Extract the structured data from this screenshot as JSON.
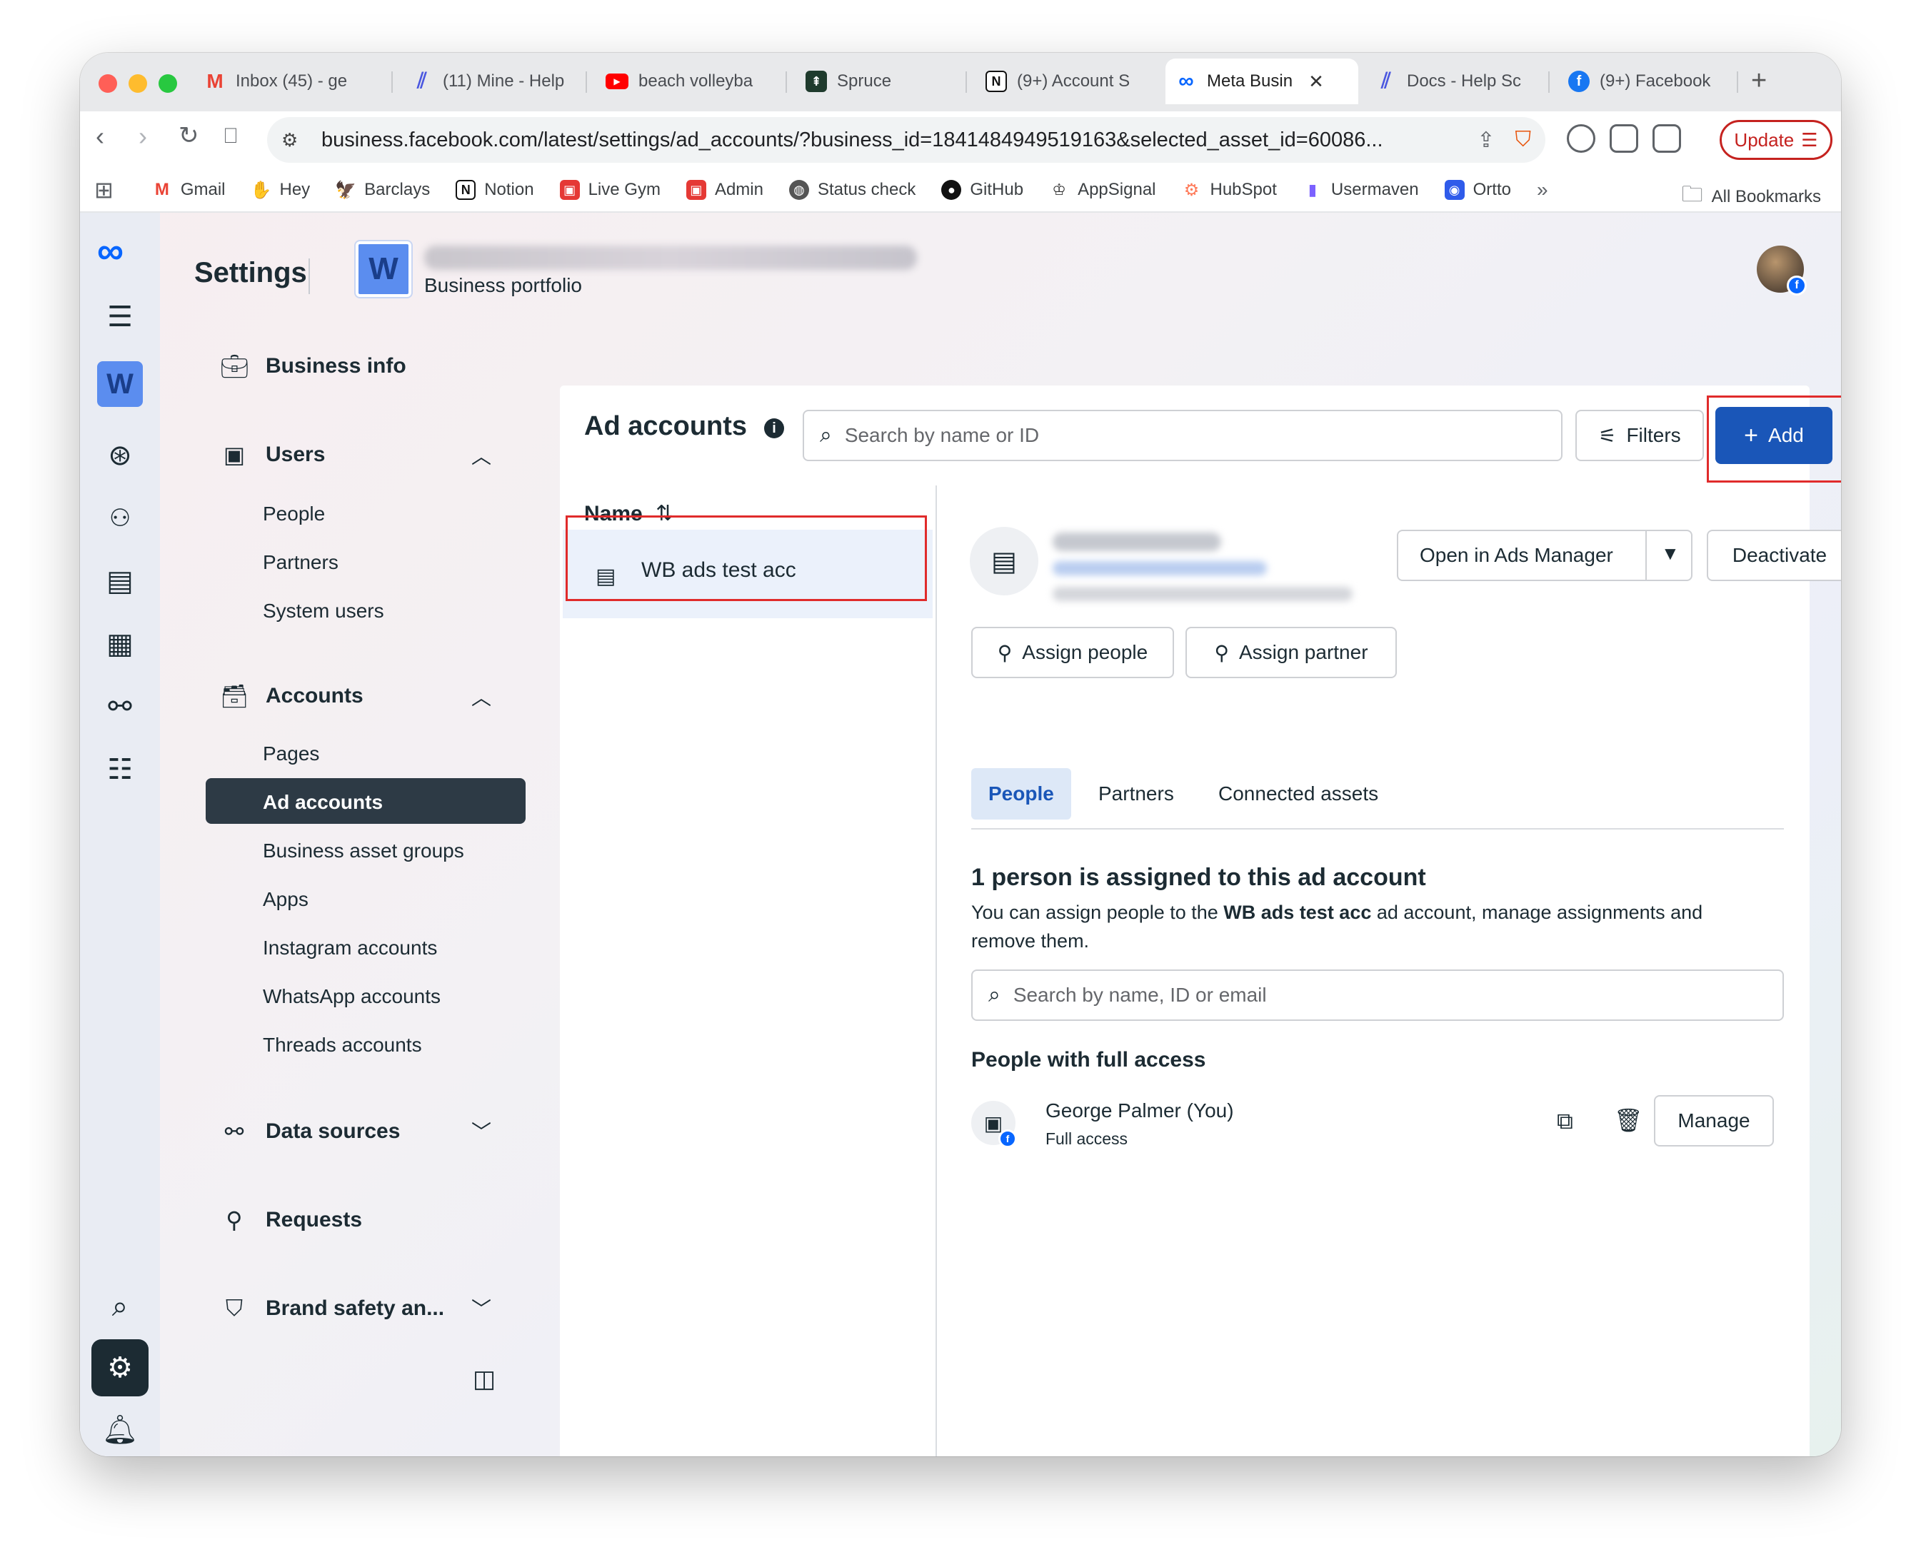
{
  "browser": {
    "tabs": [
      {
        "label": "Inbox (45) - ge",
        "icon": "gmail-icon",
        "color": "#ea4335"
      },
      {
        "label": "(11) Mine - Help",
        "icon": "helpscout-icon",
        "color": "#4a57e0"
      },
      {
        "label": "beach volleyba",
        "icon": "youtube-icon",
        "color": "#ff0000"
      },
      {
        "label": "Spruce",
        "icon": "spruce-icon",
        "color": "#1f3b2d"
      },
      {
        "label": "(9+) Account S",
        "icon": "notion-icon",
        "color": "#111111"
      },
      {
        "label": "Meta Busin",
        "icon": "meta-icon",
        "color": "#0866ff"
      },
      {
        "label": "Docs - Help Sc",
        "icon": "helpscout-icon",
        "color": "#4a57e0"
      },
      {
        "label": "(9+) Facebook",
        "icon": "facebook-icon",
        "color": "#1877f2"
      }
    ],
    "new_tab": "+",
    "url": "business.facebook.com/latest/settings/ad_accounts/?business_id=1841484949519163&selected_asset_id=60086...",
    "update_label": "Update",
    "bookmarks": [
      {
        "label": "Gmail",
        "color": "#ea4335"
      },
      {
        "label": "Hey",
        "color": "#5522fa"
      },
      {
        "label": "Barclays",
        "color": "#00aeef"
      },
      {
        "label": "Notion",
        "color": "#111111"
      },
      {
        "label": "Live Gym",
        "color": "#e53935"
      },
      {
        "label": "Admin",
        "color": "#e53935"
      },
      {
        "label": "Status check",
        "color": "#555555"
      },
      {
        "label": "GitHub",
        "color": "#111111"
      },
      {
        "label": "AppSignal",
        "color": "#333333"
      },
      {
        "label": "HubSpot",
        "color": "#ff7a59"
      },
      {
        "label": "Usermaven",
        "color": "#7b61ff"
      },
      {
        "label": "Ortto",
        "color": "#2f5bea"
      }
    ],
    "bookmarks_more": "»",
    "all_bookmarks": "All Bookmarks"
  },
  "header": {
    "title": "Settings",
    "portfolio_letter": "W",
    "portfolio_subtitle": "Business portfolio"
  },
  "rail": {
    "workspace_letter": "W",
    "help_label": "?"
  },
  "nav": {
    "business_info": "Business info",
    "users": {
      "label": "Users",
      "items": [
        "People",
        "Partners",
        "System users"
      ]
    },
    "accounts": {
      "label": "Accounts",
      "items": [
        "Pages",
        "Ad accounts",
        "Business asset groups",
        "Apps",
        "Instagram accounts",
        "WhatsApp accounts",
        "Threads accounts"
      ],
      "active": "Ad accounts"
    },
    "data_sources": "Data sources",
    "requests": "Requests",
    "brand_safety": "Brand safety an..."
  },
  "main": {
    "title": "Ad accounts",
    "search_placeholder": "Search by name or ID",
    "filters_label": "Filters",
    "add_label": "Add",
    "column_name": "Name",
    "sort_icon": "⇅",
    "ad_account_name": "WB ads test acc",
    "open_ads_manager": "Open in Ads Manager",
    "deactivate": "Deactivate",
    "assign_people": "Assign people",
    "assign_partner": "Assign partner",
    "tabs": [
      "People",
      "Partners",
      "Connected assets"
    ],
    "active_tab": "People",
    "assigned_title": "1 person is assigned to this ad account",
    "assigned_desc_pre": "You can assign people to the ",
    "assigned_desc_bold": "WB ads test acc",
    "assigned_desc_post": " ad account, manage assignments and remove them.",
    "people_search_placeholder": "Search by name, ID or email",
    "full_access_title": "People with full access",
    "person_name": "George Palmer (You)",
    "person_access": "Full access",
    "manage_label": "Manage"
  },
  "colors": {
    "primary": "#1a56b8",
    "nav_active": "#2d3a45",
    "highlight": "#e02b2b",
    "meta_blue": "#0866ff"
  }
}
